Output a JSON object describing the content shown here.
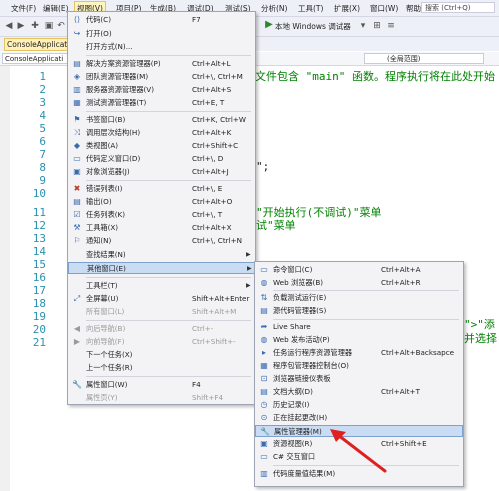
{
  "menubar": {
    "items": [
      "文件(F)",
      "编辑(E)",
      "视图(V)",
      "项目(P)",
      "生成(B)",
      "调试(D)",
      "测试(S)",
      "分析(N)",
      "工具(T)",
      "扩展(X)",
      "窗口(W)",
      "帮助(H)"
    ],
    "search_placeholder": "搜索 (Ctrl+Q)"
  },
  "toolbar": {
    "run_label": "本地 Windows 调试器"
  },
  "tab": {
    "label": "ConsoleApplication"
  },
  "navbar": {
    "project": "ConsoleApplicati",
    "scope": "(全局范围)"
  },
  "editor": {
    "line_numbers": [
      "1",
      "2",
      "3",
      "4",
      "5",
      "6",
      "7",
      "8",
      "9",
      "10",
      "11",
      "12",
      "13",
      "14",
      "15",
      "16",
      "17",
      "18",
      "19",
      "20",
      "21"
    ],
    "fragments": {
      "l1": "文件包含 \"main\" 函数。程序执行将在此处开始",
      "l7": "\";",
      "l11": "\"开始执行(不调试)\"菜单",
      "l12": "试\"菜单",
      "l19": "\">\"添",
      "l20": "并选择"
    }
  },
  "menu_view": {
    "items": [
      {
        "label": "代码(C)",
        "shortcut": "F7"
      },
      {
        "label": "打开(O)",
        "shortcut": ""
      },
      {
        "label": "打开方式(N)...",
        "shortcut": ""
      },
      {
        "label": "解决方案资源管理器(P)",
        "shortcut": "Ctrl+Alt+L"
      },
      {
        "label": "团队资源管理器(M)",
        "shortcut": "Ctrl+\\, Ctrl+M"
      },
      {
        "label": "服务器资源管理器(V)",
        "shortcut": "Ctrl+Alt+S"
      },
      {
        "label": "测试资源管理器(T)",
        "shortcut": "Ctrl+E, T"
      },
      {
        "label": "书签窗口(B)",
        "shortcut": "Ctrl+K, Ctrl+W"
      },
      {
        "label": "调用层次结构(H)",
        "shortcut": "Ctrl+Alt+K"
      },
      {
        "label": "类视图(A)",
        "shortcut": "Ctrl+Shift+C"
      },
      {
        "label": "代码定义窗口(D)",
        "shortcut": "Ctrl+\\, D"
      },
      {
        "label": "对象浏览器(J)",
        "shortcut": "Ctrl+Alt+J"
      },
      {
        "label": "错误列表(I)",
        "shortcut": "Ctrl+\\, E"
      },
      {
        "label": "输出(O)",
        "shortcut": "Ctrl+Alt+O"
      },
      {
        "label": "任务列表(K)",
        "shortcut": "Ctrl+\\, T"
      },
      {
        "label": "工具箱(X)",
        "shortcut": "Ctrl+Alt+X"
      },
      {
        "label": "通知(N)",
        "shortcut": "Ctrl+\\, Ctrl+N"
      },
      {
        "label": "查找结果(N)",
        "shortcut": ""
      },
      {
        "label": "其他窗口(E)",
        "shortcut": ""
      },
      {
        "label": "工具栏(T)",
        "shortcut": ""
      },
      {
        "label": "全屏幕(U)",
        "shortcut": "Shift+Alt+Enter"
      },
      {
        "label": "所有窗口(L)",
        "shortcut": "Shift+Alt+M"
      },
      {
        "label": "向后导航(B)",
        "shortcut": "Ctrl+-"
      },
      {
        "label": "向前导航(F)",
        "shortcut": "Ctrl+Shift+-"
      },
      {
        "label": "下一个任务(X)",
        "shortcut": ""
      },
      {
        "label": "上一个任务(R)",
        "shortcut": ""
      },
      {
        "label": "属性窗口(W)",
        "shortcut": "F4"
      },
      {
        "label": "属性页(Y)",
        "shortcut": "Shift+F4"
      }
    ]
  },
  "menu_other": {
    "items": [
      {
        "label": "命令窗口(C)",
        "shortcut": "Ctrl+Alt+A"
      },
      {
        "label": "Web 浏览器(B)",
        "shortcut": "Ctrl+Alt+R"
      },
      {
        "label": "负载测试运行(E)",
        "shortcut": ""
      },
      {
        "label": "源代码管理器(S)",
        "shortcut": ""
      },
      {
        "label": "Live Share",
        "shortcut": ""
      },
      {
        "label": "Web 发布活动(P)",
        "shortcut": ""
      },
      {
        "label": "包管理器控制台(O)",
        "shortcut": ""
      },
      {
        "label": "程序包管理器控制台(O)",
        "shortcut": ""
      },
      {
        "label": "浏览器链接仪表板",
        "shortcut": ""
      },
      {
        "label": "文档大纲(D)",
        "shortcut": "Ctrl+Alt+T"
      },
      {
        "label": "历史记录(I)",
        "shortcut": ""
      },
      {
        "label": "正在挂起更改(H)",
        "shortcut": ""
      },
      {
        "label": "属性管理器(M)",
        "shortcut": ""
      },
      {
        "label": "资源视图(R)",
        "shortcut": "Ctrl+Shift+E"
      },
      {
        "label": "C# 交互窗口",
        "shortcut": ""
      },
      {
        "label": "代码度量值结果(M)",
        "shortcut": ""
      }
    ],
    "task_override": "任务运行程序资源管理器",
    "task_shortcut": "Ctrl+Alt+Backsapce"
  }
}
